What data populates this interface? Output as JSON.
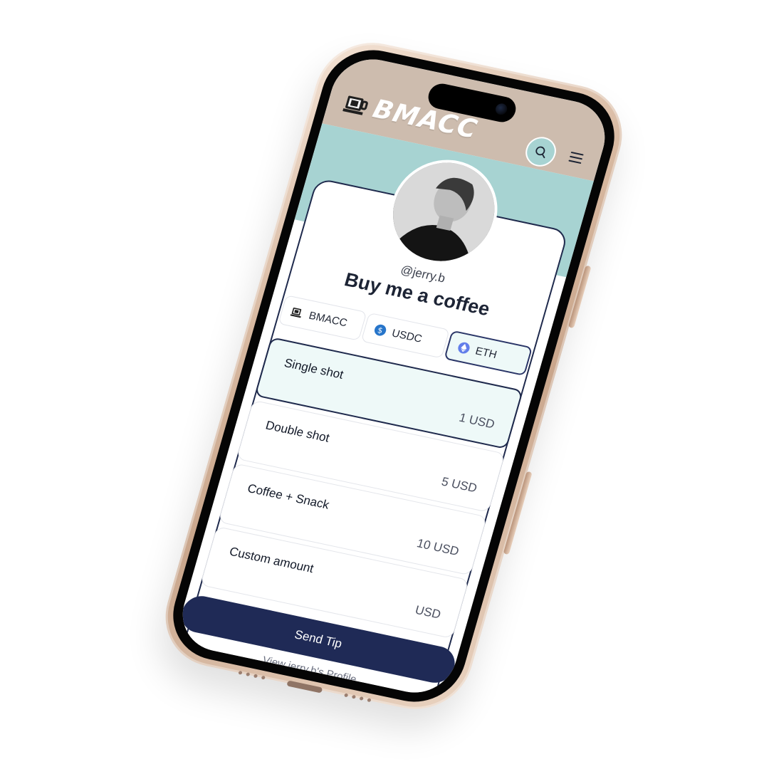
{
  "header": {
    "brand": "BMACC",
    "search_icon": "search-icon",
    "menu_icon": "menu-icon",
    "colors": {
      "header_bg": "#cdbcae",
      "banner_bg": "#a7d3d2"
    }
  },
  "profile": {
    "handle": "@jerry.b",
    "title": "Buy me a coffee"
  },
  "tokens": [
    {
      "label": "BMACC",
      "icon": "bmacc-logo-icon"
    },
    {
      "label": "USDC",
      "icon": "usdc-icon"
    },
    {
      "label": "ETH",
      "icon": "eth-icon",
      "selected": true
    }
  ],
  "options": [
    {
      "name": "Single shot",
      "price": "1 USD",
      "selected": true
    },
    {
      "name": "Double shot",
      "price": "5 USD"
    },
    {
      "name": "Coffee + Snack",
      "price": "10 USD"
    },
    {
      "name": "Custom amount",
      "price": "USD"
    }
  ],
  "actions": {
    "send_label": "Send Tip",
    "profile_link": "View jerry.b's Profile"
  },
  "colors": {
    "primary": "#1f2a56",
    "selected_bg": "#eef9f8"
  }
}
